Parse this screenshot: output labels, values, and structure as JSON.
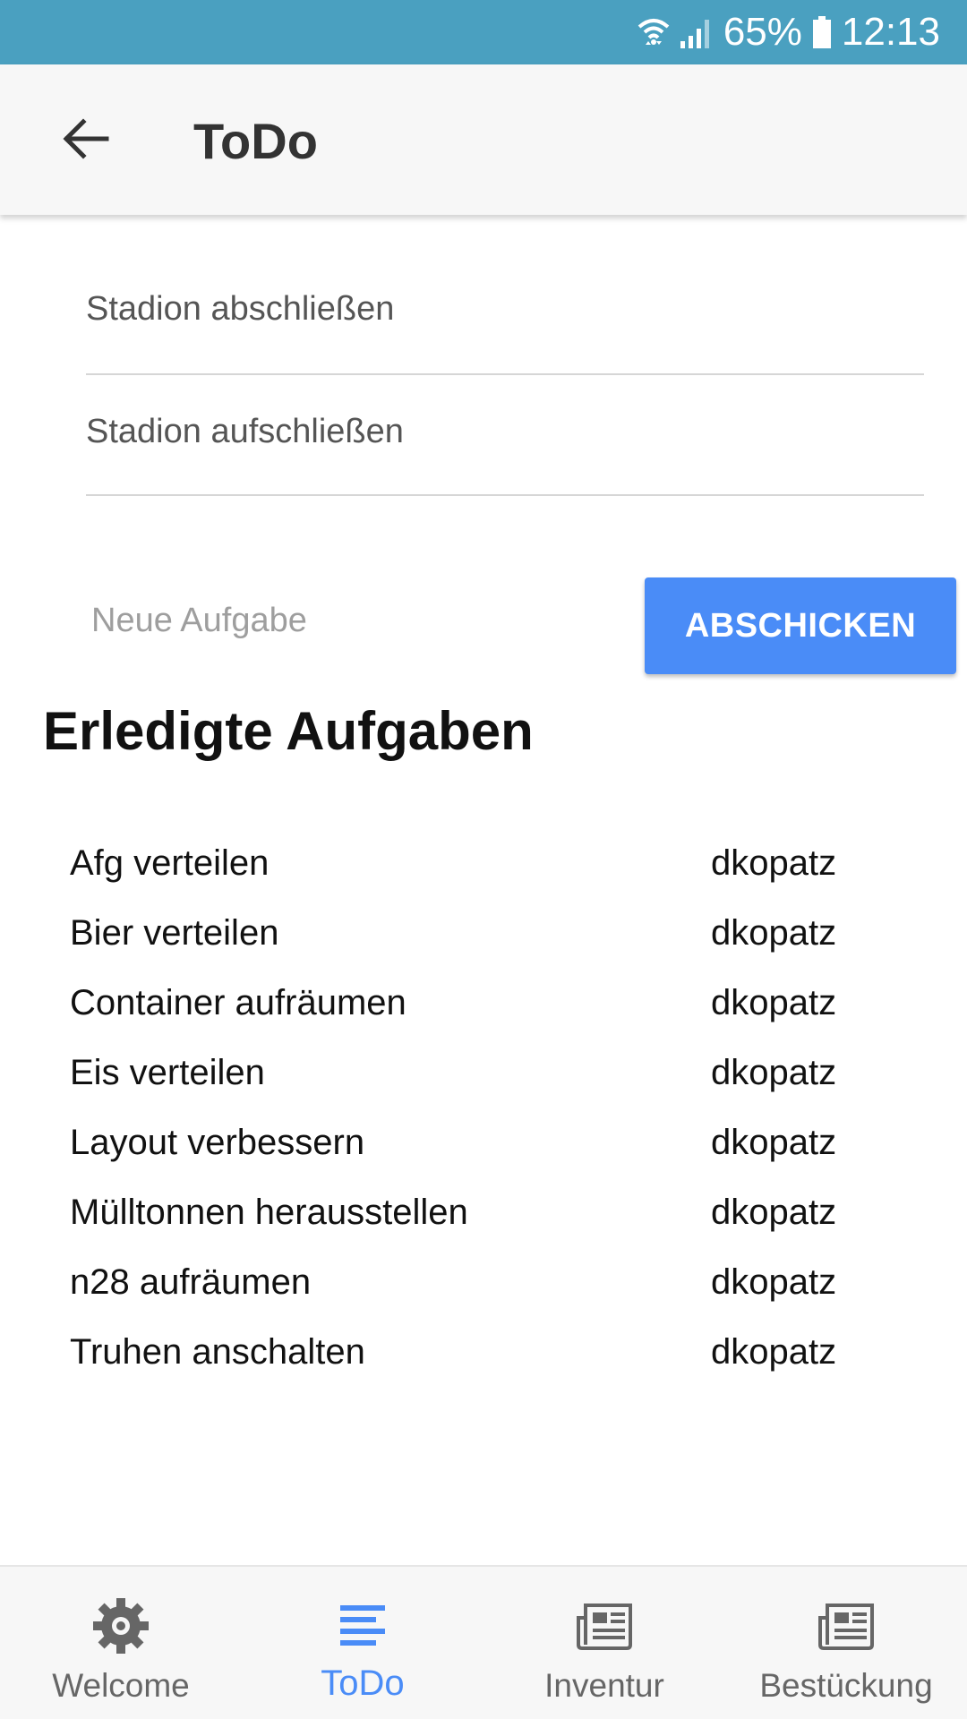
{
  "status_bar": {
    "battery_percent": "65%",
    "time": "12:13",
    "icons": [
      "wifi-icon",
      "signal-icon",
      "battery-icon"
    ],
    "background_color": "#4aa0c0"
  },
  "app_bar": {
    "title": "ToDo",
    "back_icon": "arrow-left-icon"
  },
  "open_tasks": [
    {
      "label": "Stadion abschließen"
    },
    {
      "label": "Stadion aufschließen"
    }
  ],
  "new_task": {
    "placeholder": "Neue Aufgabe",
    "value": "",
    "submit_label": "ABSCHICKEN",
    "submit_color": "#4a8cf7"
  },
  "done_section": {
    "heading": "Erledigte Aufgaben",
    "rows": [
      {
        "task": "Afg verteilen",
        "user": "dkopatz"
      },
      {
        "task": "Bier verteilen",
        "user": "dkopatz"
      },
      {
        "task": "Container aufräumen",
        "user": "dkopatz"
      },
      {
        "task": "Eis verteilen",
        "user": "dkopatz"
      },
      {
        "task": "Layout verbessern",
        "user": "dkopatz"
      },
      {
        "task": "Mülltonnen herausstellen",
        "user": "dkopatz"
      },
      {
        "task": "n28 aufräumen",
        "user": "dkopatz"
      },
      {
        "task": "Truhen anschalten",
        "user": "dkopatz"
      }
    ]
  },
  "bottom_nav": {
    "active": "ToDo",
    "accent_color": "#4a8cf7",
    "items": [
      {
        "label": "Welcome",
        "icon": "gear-icon"
      },
      {
        "label": "ToDo",
        "icon": "list-icon"
      },
      {
        "label": "Inventur",
        "icon": "newspaper-icon"
      },
      {
        "label": "Bestückung",
        "icon": "newspaper-icon"
      }
    ]
  }
}
